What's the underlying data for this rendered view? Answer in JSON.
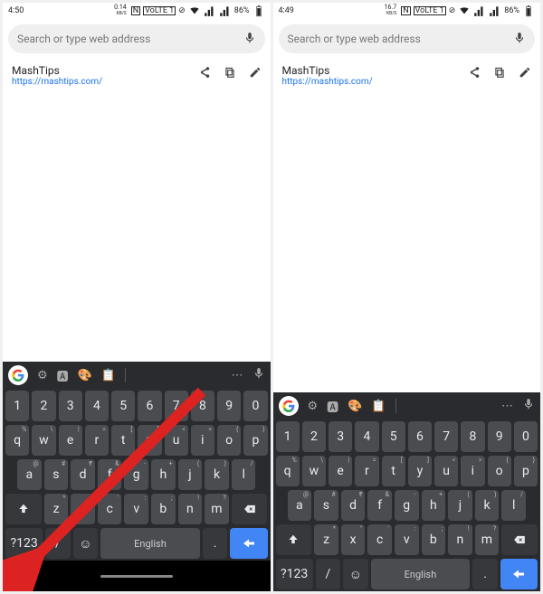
{
  "panels": [
    {
      "status": {
        "time": "4:50",
        "speed_value": "0.14",
        "speed_unit": "KB/S",
        "nfc": "N",
        "volte": "VoLTE 1",
        "battery": "86%"
      },
      "search": {
        "placeholder": "Search or type web address"
      },
      "suggestion": {
        "title": "MashTips",
        "url": "https://mashtips.com/"
      },
      "keyboard": {
        "numbers": [
          "1",
          "2",
          "3",
          "4",
          "5",
          "6",
          "7",
          "8",
          "9",
          "0"
        ],
        "row1": [
          "q",
          "w",
          "e",
          "r",
          "t",
          "y",
          "u",
          "i",
          "o",
          "p"
        ],
        "row1_sup": [
          "%",
          "\\",
          "|",
          "=",
          "[",
          "]",
          "<",
          ">",
          "{",
          "}"
        ],
        "row2": [
          "a",
          "s",
          "d",
          "f",
          "g",
          "h",
          "j",
          "k",
          "l"
        ],
        "row2_sup": [
          "@",
          "#",
          "₹",
          "&",
          "-",
          "+",
          "(",
          ")",
          "/"
        ],
        "row3": [
          "z",
          "x",
          "c",
          "v",
          "b",
          "n",
          "m"
        ],
        "row3_sup": [
          "*",
          "\"",
          "'",
          ":",
          ";",
          "!",
          "?"
        ],
        "mode_key": "?123",
        "slash_key": "/",
        "space_label": "English",
        "period_key": "."
      },
      "has_arrow": true,
      "has_navbar": true
    },
    {
      "status": {
        "time": "4:49",
        "speed_value": "16.7",
        "speed_unit": "KB/S",
        "nfc": "N",
        "volte": "VoLTE 1",
        "battery": "86%"
      },
      "search": {
        "placeholder": "Search or type web address"
      },
      "suggestion": {
        "title": "MashTips",
        "url": "https://mashtips.com/"
      },
      "keyboard": {
        "numbers": [
          "1",
          "2",
          "3",
          "4",
          "5",
          "6",
          "7",
          "8",
          "9",
          "0"
        ],
        "row1": [
          "q",
          "w",
          "e",
          "r",
          "t",
          "y",
          "u",
          "i",
          "o",
          "p"
        ],
        "row1_sup": [
          "%",
          "\\",
          "|",
          "=",
          "[",
          "]",
          "<",
          ">",
          "{",
          "}"
        ],
        "row2": [
          "a",
          "s",
          "d",
          "f",
          "g",
          "h",
          "j",
          "k",
          "l"
        ],
        "row2_sup": [
          "@",
          "#",
          "₹",
          "&",
          "-",
          "+",
          "(",
          ")",
          "/"
        ],
        "row3": [
          "z",
          "x",
          "c",
          "v",
          "b",
          "n",
          "m"
        ],
        "row3_sup": [
          "*",
          "\"",
          "'",
          ":",
          ";",
          "!",
          "?"
        ],
        "mode_key": "?123",
        "slash_key": "/",
        "space_label": "English",
        "period_key": "."
      },
      "has_arrow": false,
      "has_navbar": false
    }
  ]
}
